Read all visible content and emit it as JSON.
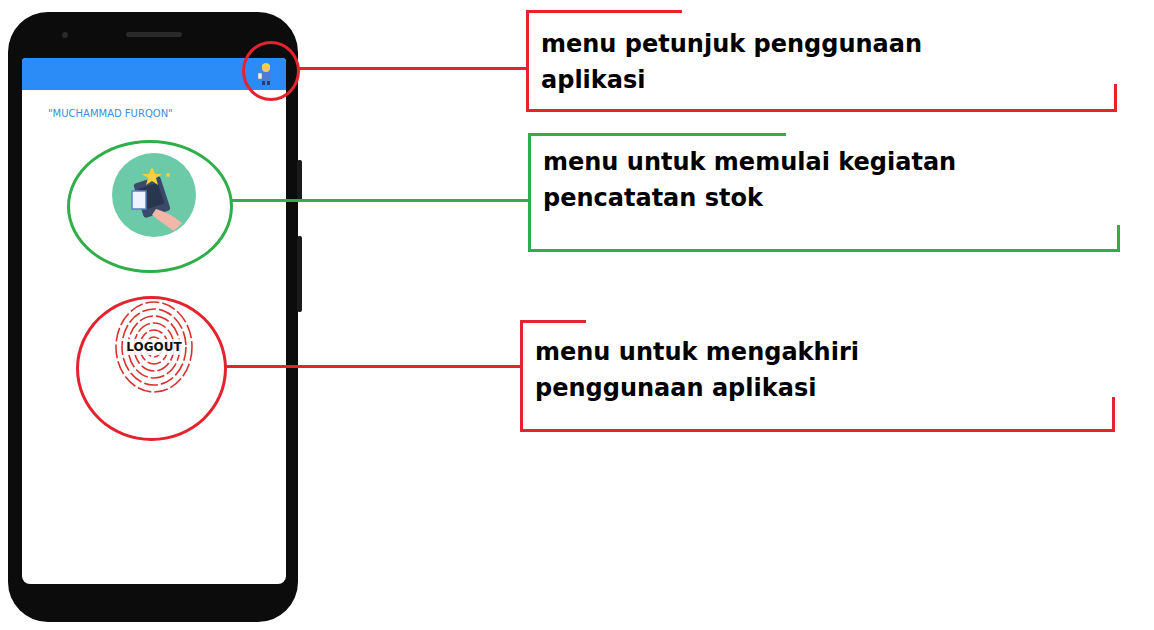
{
  "screen": {
    "user_name": "\"MUCHAMMAD FURQON\"",
    "logout_button": {
      "label": "LOGOUT"
    }
  },
  "callouts": [
    {
      "lines": [
        "menu petunjuk penggunaan",
        "aplikasi"
      ],
      "color": "#e3232d"
    },
    {
      "lines": [
        "menu untuk memulai kegiatan",
        "pencatatan stok"
      ],
      "color": "#2fae4a"
    },
    {
      "lines": [
        "menu untuk mengakhiri",
        "penggunaan aplikasi"
      ],
      "color": "#e3232d"
    }
  ]
}
